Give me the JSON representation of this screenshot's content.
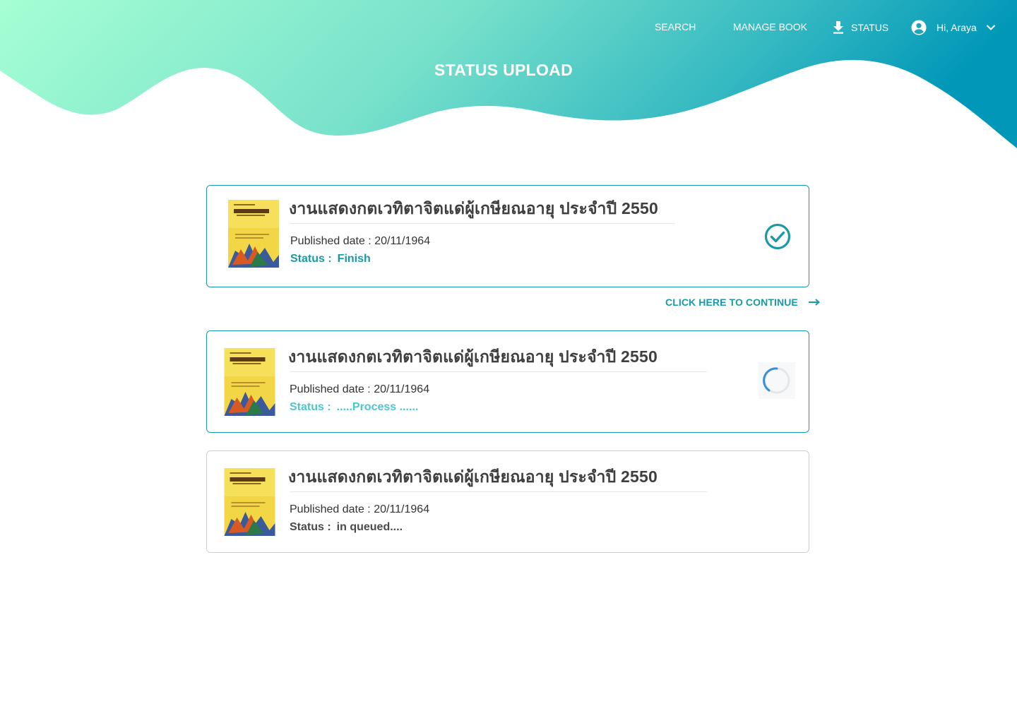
{
  "header": {
    "title": "STATUS UPLOAD",
    "nav": {
      "search": "SEARCH",
      "manage_book": "MANAGE BOOK",
      "status": "STATUS",
      "user_greeting": "Hi, Araya"
    },
    "gradient": [
      "#a6ffd4",
      "#79e2cb",
      "#35b9c2",
      "#0097b8"
    ]
  },
  "colors": {
    "accent": "#1a9aa6",
    "process": "#4cc7d0",
    "spinner": "#3a8fd9"
  },
  "uploads": [
    {
      "title": "งานแสดงกตเวทิตาจิตแด่ผู้เกษียณอายุ ประจำปี 2550",
      "published_label": "Published date : 20/11/1964",
      "status_label": "Status :",
      "status_value": "Finish",
      "state": "finished",
      "icon": "check-circle-icon"
    },
    {
      "title": "งานแสดงกตเวทิตาจิตแด่ผู้เกษียณอายุ ประจำปี 2550",
      "published_label": "Published date : 20/11/1964",
      "status_label": "Status :",
      "status_value": ".....Process ......",
      "state": "processing",
      "icon": "loading-spinner-icon"
    },
    {
      "title": "งานแสดงกตเวทิตาจิตแด่ผู้เกษียณอายุ ประจำปี 2550",
      "published_label": "Published date : 20/11/1964",
      "status_label": "Status :",
      "status_value": "in queued....",
      "state": "queued",
      "icon": ""
    }
  ],
  "continue_link": "CLICK HERE TO CONTINUE"
}
